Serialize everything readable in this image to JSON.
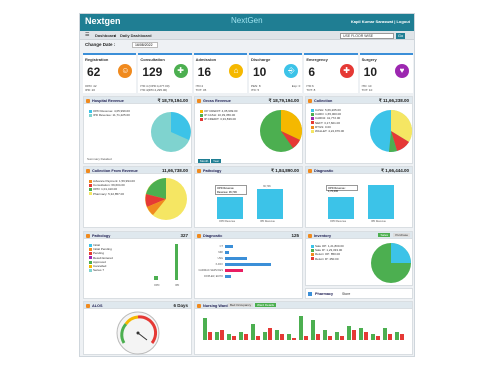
{
  "app": {
    "brand": "Nextgen",
    "center_logo": "Next",
    "center_logo2": "Gen",
    "user": "Kapil Kumar Saraswat | Logout"
  },
  "sub": {
    "crumb1": "Dashboard",
    "crumb2": "Daily Dashboard",
    "unit": "USE FLOOR WISE",
    "go": "Go"
  },
  "date": {
    "label": "Change Date :",
    "value": "16/08/2022"
  },
  "kpis": [
    {
      "title": "Registration",
      "value": "62",
      "s1": "OPD: 42",
      "s2": "IPD: 20",
      "s3": "",
      "color": "#f08a1e",
      "icon": "☺"
    },
    {
      "title": "Consultation",
      "value": "129",
      "s1": "ITD:4 (OPD:4,277.00)",
      "s2": "ITD:4(IPD:4,295.00)",
      "s3": "",
      "color": "#4caf50",
      "icon": "✚"
    },
    {
      "title": "Admission",
      "value": "16",
      "s1": "ITD:4",
      "s2": "TOT: 45",
      "s3": "",
      "color": "#f5b800",
      "icon": "⌂"
    },
    {
      "title": "Discharge",
      "value": "10",
      "s1": "PEN: 8",
      "s2": "ITD: 5",
      "s3": "Exp: 0",
      "color": "#3cc3e8",
      "icon": "⎆"
    },
    {
      "title": "Emergency",
      "value": "6",
      "s1": "ITD:6",
      "s2": "TOT: 8",
      "s3": "",
      "color": "#e53935",
      "icon": "✚"
    },
    {
      "title": "Surgery",
      "value": "10",
      "s1": "ITD: 10",
      "s2": "TOT: 10",
      "s3": "",
      "color": "#9c27b0",
      "icon": "♥"
    }
  ],
  "panels": {
    "hosp": {
      "title": "Hospital Revenue",
      "value": "₹ 18,79,194.00",
      "legend": [
        "OPD Revenue: 4,05,999.00",
        "IPD Revenue: 11,71,225.00"
      ],
      "foot": "Summary  Detailed"
    },
    "gross": {
      "title": "Gross Revenue",
      "value": "₹ 18,79,194.00",
      "legend": [
        "OP CREDIT: 4,05,999.00",
        "IP CASH: 10,39,356.00",
        "IP CREDIT: 3,33,839.00"
      ],
      "foot1": "Month",
      "foot2": "Year"
    },
    "coll": {
      "title": "Collection",
      "sub": "(By Mode)",
      "value": "₹ 11,66,238.00",
      "legend": [
        "CASH: 5,66,205.00",
        "CARD: 1,65,000.00",
        "CARD2: 41,772.00",
        "NEFT: 3,17,601.00",
        "RTGS: 0.00",
        "WALLET: 4,24,976.00"
      ]
    },
    "cfr": {
      "title": "Collection From Revenue",
      "sub": "(OPD/IPD)",
      "value": "11,66,738.00",
      "legend": [
        "Advance Payment: 1,59,994.00",
        "Consultation: 69,604.00",
        "OPD: 1,01,410.00",
        "Pharmacy: 5,32,857.00"
      ]
    },
    "path": {
      "title": "Pathology",
      "sub": "(Revenue)",
      "value": "₹ 1,84,890.00",
      "tip1": "OPD Revenue",
      "tip2": "Revenue: 36,706",
      "bar1": "36,706",
      "x1": "OPD Revenue",
      "x2": "IPD Revenue"
    },
    "diag": {
      "title": "Diagnostic",
      "sub": "(Revenue)",
      "value": "₹ 1,66,444.00",
      "tip": "OPD Revenue: 1,70,000",
      "x1": "OPD Revenue",
      "x2": "IPD Revenue"
    },
    "pathcount": {
      "title": "Pathology",
      "sub": "(Summary)",
      "value": "327",
      "legend": [
        "Initial",
        "Initial Pending",
        "Pending",
        "Result Entered",
        "Approved",
        "Cancelled",
        "Series 7"
      ],
      "x1": "OPD",
      "x2": "IPD"
    },
    "diagcount": {
      "title": "Diagnostic",
      "sub": "(Summary)",
      "value": "125",
      "rows": [
        "CT",
        "MRI",
        "USG",
        "X-RAY",
        "CARDIAC SERVICES",
        "DOPLER, ECHO"
      ]
    },
    "inv": {
      "title": "Inventory",
      "sub": "(Sale Purchase)",
      "b1": "Sales",
      "b2": "Purchase",
      "legend": [
        "Sale OP: 1,21,800.00",
        "Sale IP: 1,23,333.00",
        "Return OP: 850.00",
        "Return IP: 450.00"
      ]
    },
    "pharm": {
      "title": "Pharmacy",
      "store": "Store"
    },
    "alos": {
      "title": "ALOS",
      "sub": "(Day)",
      "value": "6 Days"
    },
    "nursing": {
      "title": "Nursing Ward",
      "b1": "Bed Occupancy",
      "b2": "Ward Details"
    }
  }
}
